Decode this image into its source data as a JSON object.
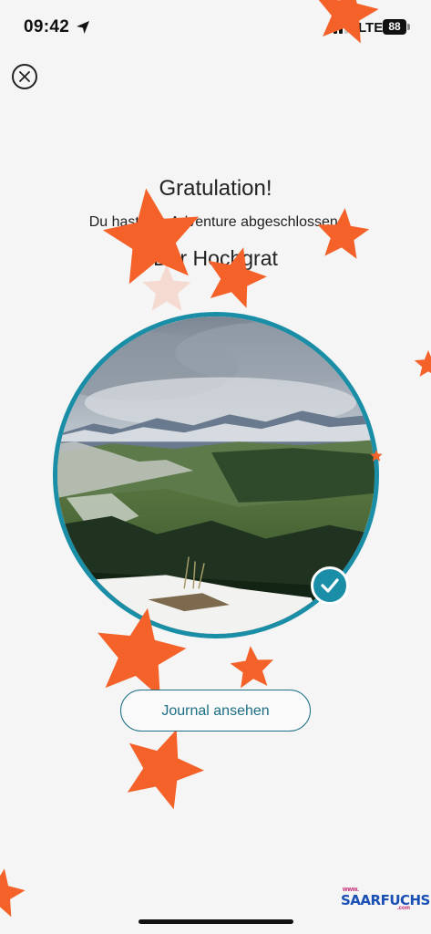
{
  "status_bar": {
    "time": "09:42",
    "network": "LTE",
    "battery": "88"
  },
  "icons": {
    "close": "close-icon",
    "location": "location-arrow-icon",
    "check": "check-icon"
  },
  "completion": {
    "title": "Gratulation!",
    "subtitle": "Du hast das Adventure abgeschlossen.",
    "adventure_name": "Der Hochgrat"
  },
  "actions": {
    "journal_label": "Journal ansehen"
  },
  "branding": {
    "www": "www.",
    "name": "SAARFUCHS",
    "com": ".com"
  },
  "colors": {
    "accent": "#1a8ea6",
    "button_text": "#1c6f84",
    "confetti": "#f4622a",
    "background": "#f5f5f5"
  }
}
